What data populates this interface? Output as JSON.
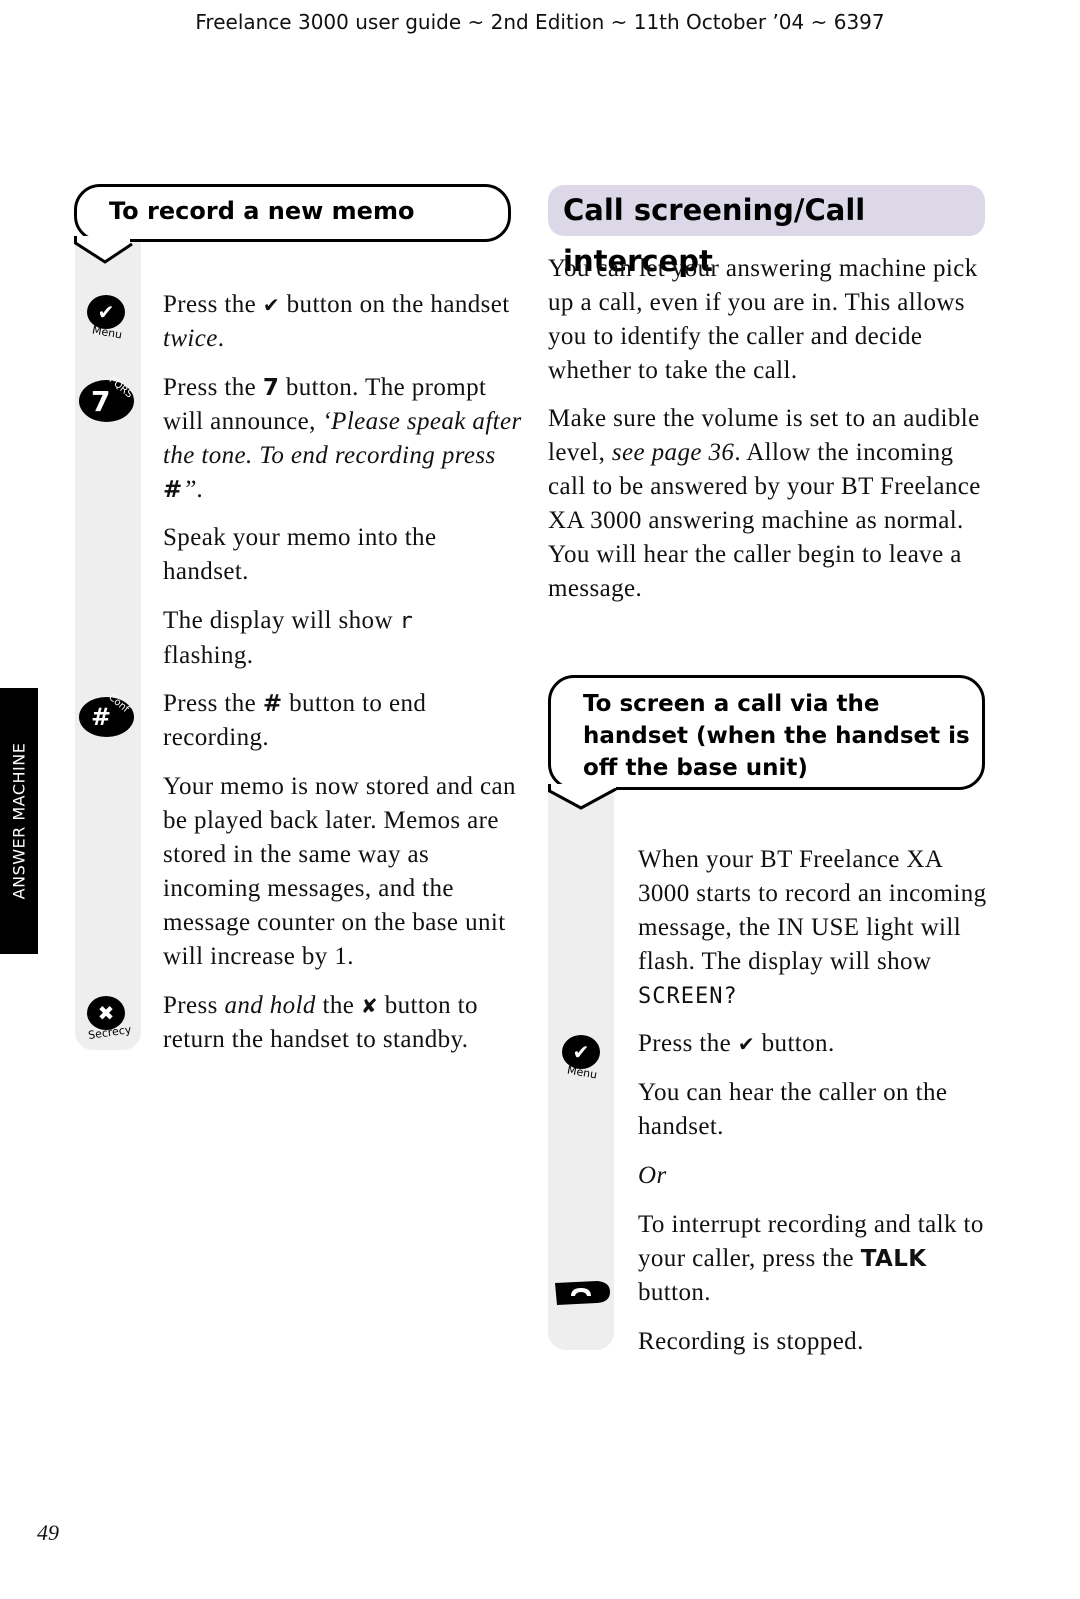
{
  "header": {
    "text": "Freelance 3000 user guide ~ 2nd Edition ~ 11th October ’04 ~ 6397"
  },
  "side_tab": {
    "label": "ANSWER MACHINE"
  },
  "left": {
    "heading": "To record a new memo",
    "steps": [
      {
        "icon": "menu-check-icon",
        "caption": "Menu",
        "parts": [
          "Press the ",
          "✔",
          " button on the handset ",
          "twice",
          "."
        ]
      },
      {
        "icon": "key-7-icon",
        "key": "7",
        "letters": "PQRS",
        "parts": [
          "Press the ",
          "7",
          " button. The prompt will announce, ",
          "‘Please speak after the tone. To end recording press ",
          "#",
          "”."
        ]
      },
      {
        "parts": [
          "Speak your memo into the handset."
        ]
      },
      {
        "parts": [
          "The display will show ",
          "r",
          " flashing."
        ]
      },
      {
        "icon": "key-hash-icon",
        "key": "#",
        "letters": "Conf",
        "parts": [
          "Press the ",
          "#",
          " button to end recording."
        ]
      },
      {
        "parts": [
          "Your memo is now stored and can be played back later. Memos are stored in the same way as incoming messages, and the message counter on the base unit will increase by 1."
        ]
      },
      {
        "icon": "secrecy-x-icon",
        "caption": "Secrecy",
        "parts": [
          "Press ",
          "and hold",
          " the ",
          "✘",
          " button to return the handset to standby."
        ]
      }
    ]
  },
  "right": {
    "title": "Call screening/Call intercept",
    "intro": [
      "You can let your answering machine pick up a call, even if you are in. This allows you to identify the caller and decide whether to take the call.",
      [
        "Make sure the volume is set to an audible level, ",
        "see page 36",
        ". Allow the incoming call to be answered by your BT Freelance XA 3000 answering machine as normal. You will hear the caller begin to leave a message."
      ]
    ],
    "sub_heading": "To screen a call via the handset (when the handset is off the base unit)",
    "steps": [
      {
        "parts": [
          "When your BT Freelance XA 3000 starts to record an incoming message, the IN USE light will flash. The display will show ",
          "SCREEN?"
        ]
      },
      {
        "icon": "menu-check-icon",
        "caption": "Menu",
        "parts": [
          "Press the ",
          "✔",
          " button."
        ]
      },
      {
        "parts": [
          "You can hear the caller on the handset."
        ]
      },
      {
        "parts": [
          "Or"
        ]
      },
      {
        "icon": "talk-phone-icon",
        "parts": [
          "To interrupt recording and talk to your caller, press the ",
          "TALK",
          " button."
        ]
      },
      {
        "parts": [
          "Recording is stopped."
        ]
      }
    ]
  },
  "footer": {
    "page_number": "49"
  }
}
